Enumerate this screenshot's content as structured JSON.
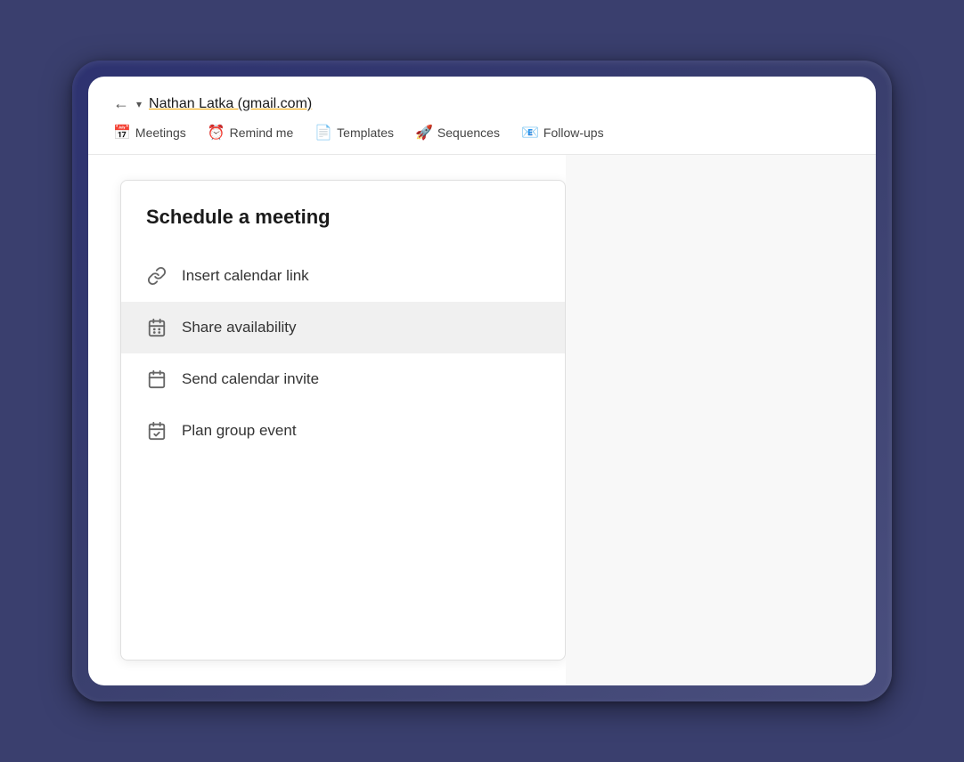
{
  "frame": {
    "email_label": "Nathan Latka (gmail.com)"
  },
  "toolbar": {
    "nav_items": [
      {
        "id": "meetings",
        "emoji": "📅",
        "label": "Meetings"
      },
      {
        "id": "remind-me",
        "emoji": "⏰",
        "label": "Remind me"
      },
      {
        "id": "templates",
        "emoji": "📄",
        "label": "Templates"
      },
      {
        "id": "sequences",
        "emoji": "🚀",
        "label": "Sequences"
      },
      {
        "id": "follow-ups",
        "emoji": "📧",
        "label": "Follow-ups"
      }
    ]
  },
  "dropdown": {
    "title": "Schedule a meeting",
    "items": [
      {
        "id": "insert-calendar-link",
        "label": "Insert calendar link",
        "icon": "link",
        "active": false
      },
      {
        "id": "share-availability",
        "label": "Share availability",
        "icon": "calendar-grid",
        "active": true
      },
      {
        "id": "send-calendar-invite",
        "label": "Send calendar invite",
        "icon": "calendar",
        "active": false
      },
      {
        "id": "plan-group-event",
        "label": "Plan group event",
        "icon": "calendar-check",
        "active": false
      }
    ]
  }
}
